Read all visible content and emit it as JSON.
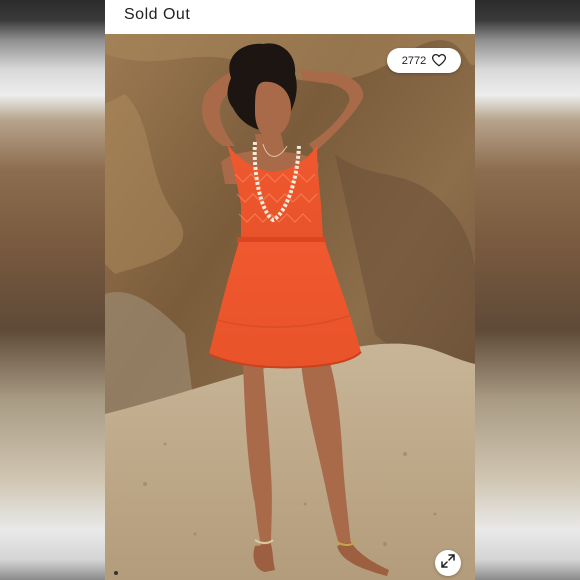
{
  "header": {
    "status_label": "Sold Out"
  },
  "listing": {
    "like_count": "2772",
    "like_icon": "heart-outline-icon",
    "expand_icon": "expand-arrows-icon"
  },
  "colors": {
    "dress": "#f2552c",
    "rock": "#8a6a45",
    "sand": "#bda98b",
    "status_text": "#222222"
  }
}
